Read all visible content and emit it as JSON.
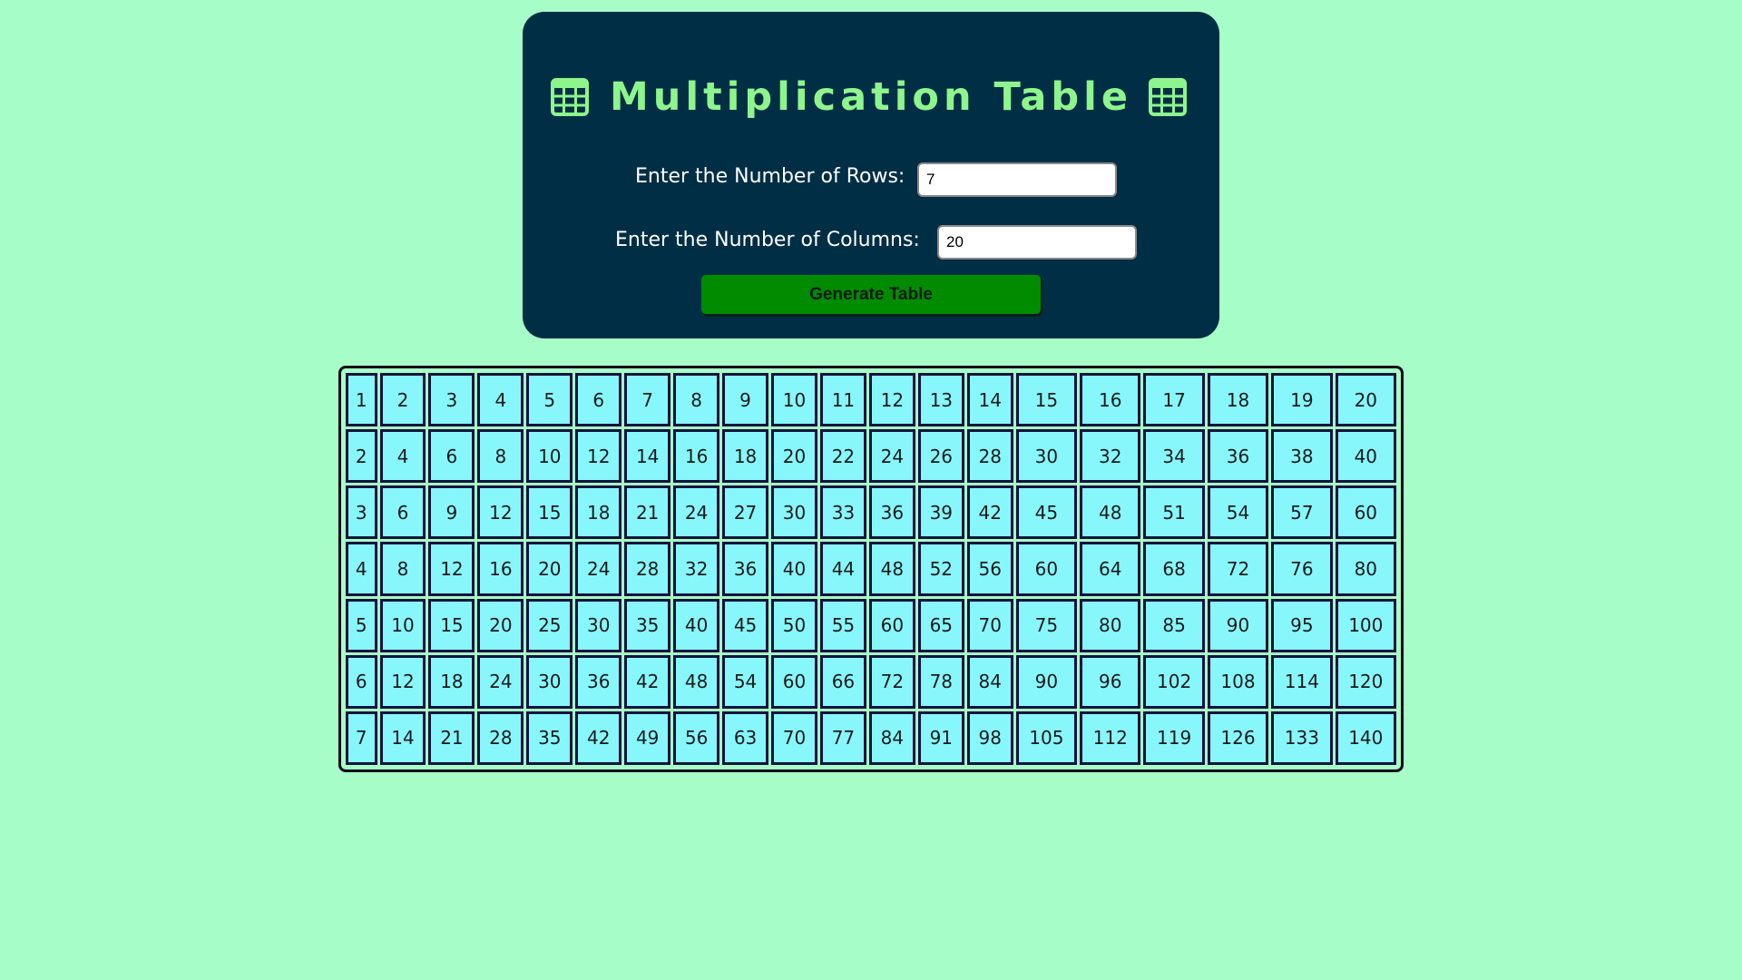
{
  "header": {
    "title": "Multiplication Table",
    "left_icon": "table-grid-icon",
    "right_icon": "table-grid-icon"
  },
  "form": {
    "rows_label": "Enter the Number of Rows:",
    "rows_value": "7",
    "columns_label": "Enter the Number of Columns:",
    "columns_value": "20",
    "generate_label": "Generate Table"
  },
  "colors": {
    "page_background": "#a7fdc7",
    "panel_background": "#002e45",
    "title_color": "#8ef58d",
    "button_background": "#008b00",
    "cell_background": "#87f7fc",
    "cell_border": "#14143c"
  },
  "table": {
    "rows": [
      [
        "1",
        "2",
        "3",
        "4",
        "5",
        "6",
        "7",
        "8",
        "9",
        "10",
        "11",
        "12",
        "13",
        "14",
        "15",
        "16",
        "17",
        "18",
        "19",
        "20"
      ],
      [
        "2",
        "4",
        "6",
        "8",
        "10",
        "12",
        "14",
        "16",
        "18",
        "20",
        "22",
        "24",
        "26",
        "28",
        "30",
        "32",
        "34",
        "36",
        "38",
        "40"
      ],
      [
        "3",
        "6",
        "9",
        "12",
        "15",
        "18",
        "21",
        "24",
        "27",
        "30",
        "33",
        "36",
        "39",
        "42",
        "45",
        "48",
        "51",
        "54",
        "57",
        "60"
      ],
      [
        "4",
        "8",
        "12",
        "16",
        "20",
        "24",
        "28",
        "32",
        "36",
        "40",
        "44",
        "48",
        "52",
        "56",
        "60",
        "64",
        "68",
        "72",
        "76",
        "80"
      ],
      [
        "5",
        "10",
        "15",
        "20",
        "25",
        "30",
        "35",
        "40",
        "45",
        "50",
        "55",
        "60",
        "65",
        "70",
        "75",
        "80",
        "85",
        "90",
        "95",
        "100"
      ],
      [
        "6",
        "12",
        "18",
        "24",
        "30",
        "36",
        "42",
        "48",
        "54",
        "60",
        "66",
        "72",
        "78",
        "84",
        "90",
        "96",
        "102",
        "108",
        "114",
        "120"
      ],
      [
        "7",
        "14",
        "21",
        "28",
        "35",
        "42",
        "49",
        "56",
        "63",
        "70",
        "77",
        "84",
        "91",
        "98",
        "105",
        "112",
        "119",
        "126",
        "133",
        "140"
      ]
    ]
  }
}
